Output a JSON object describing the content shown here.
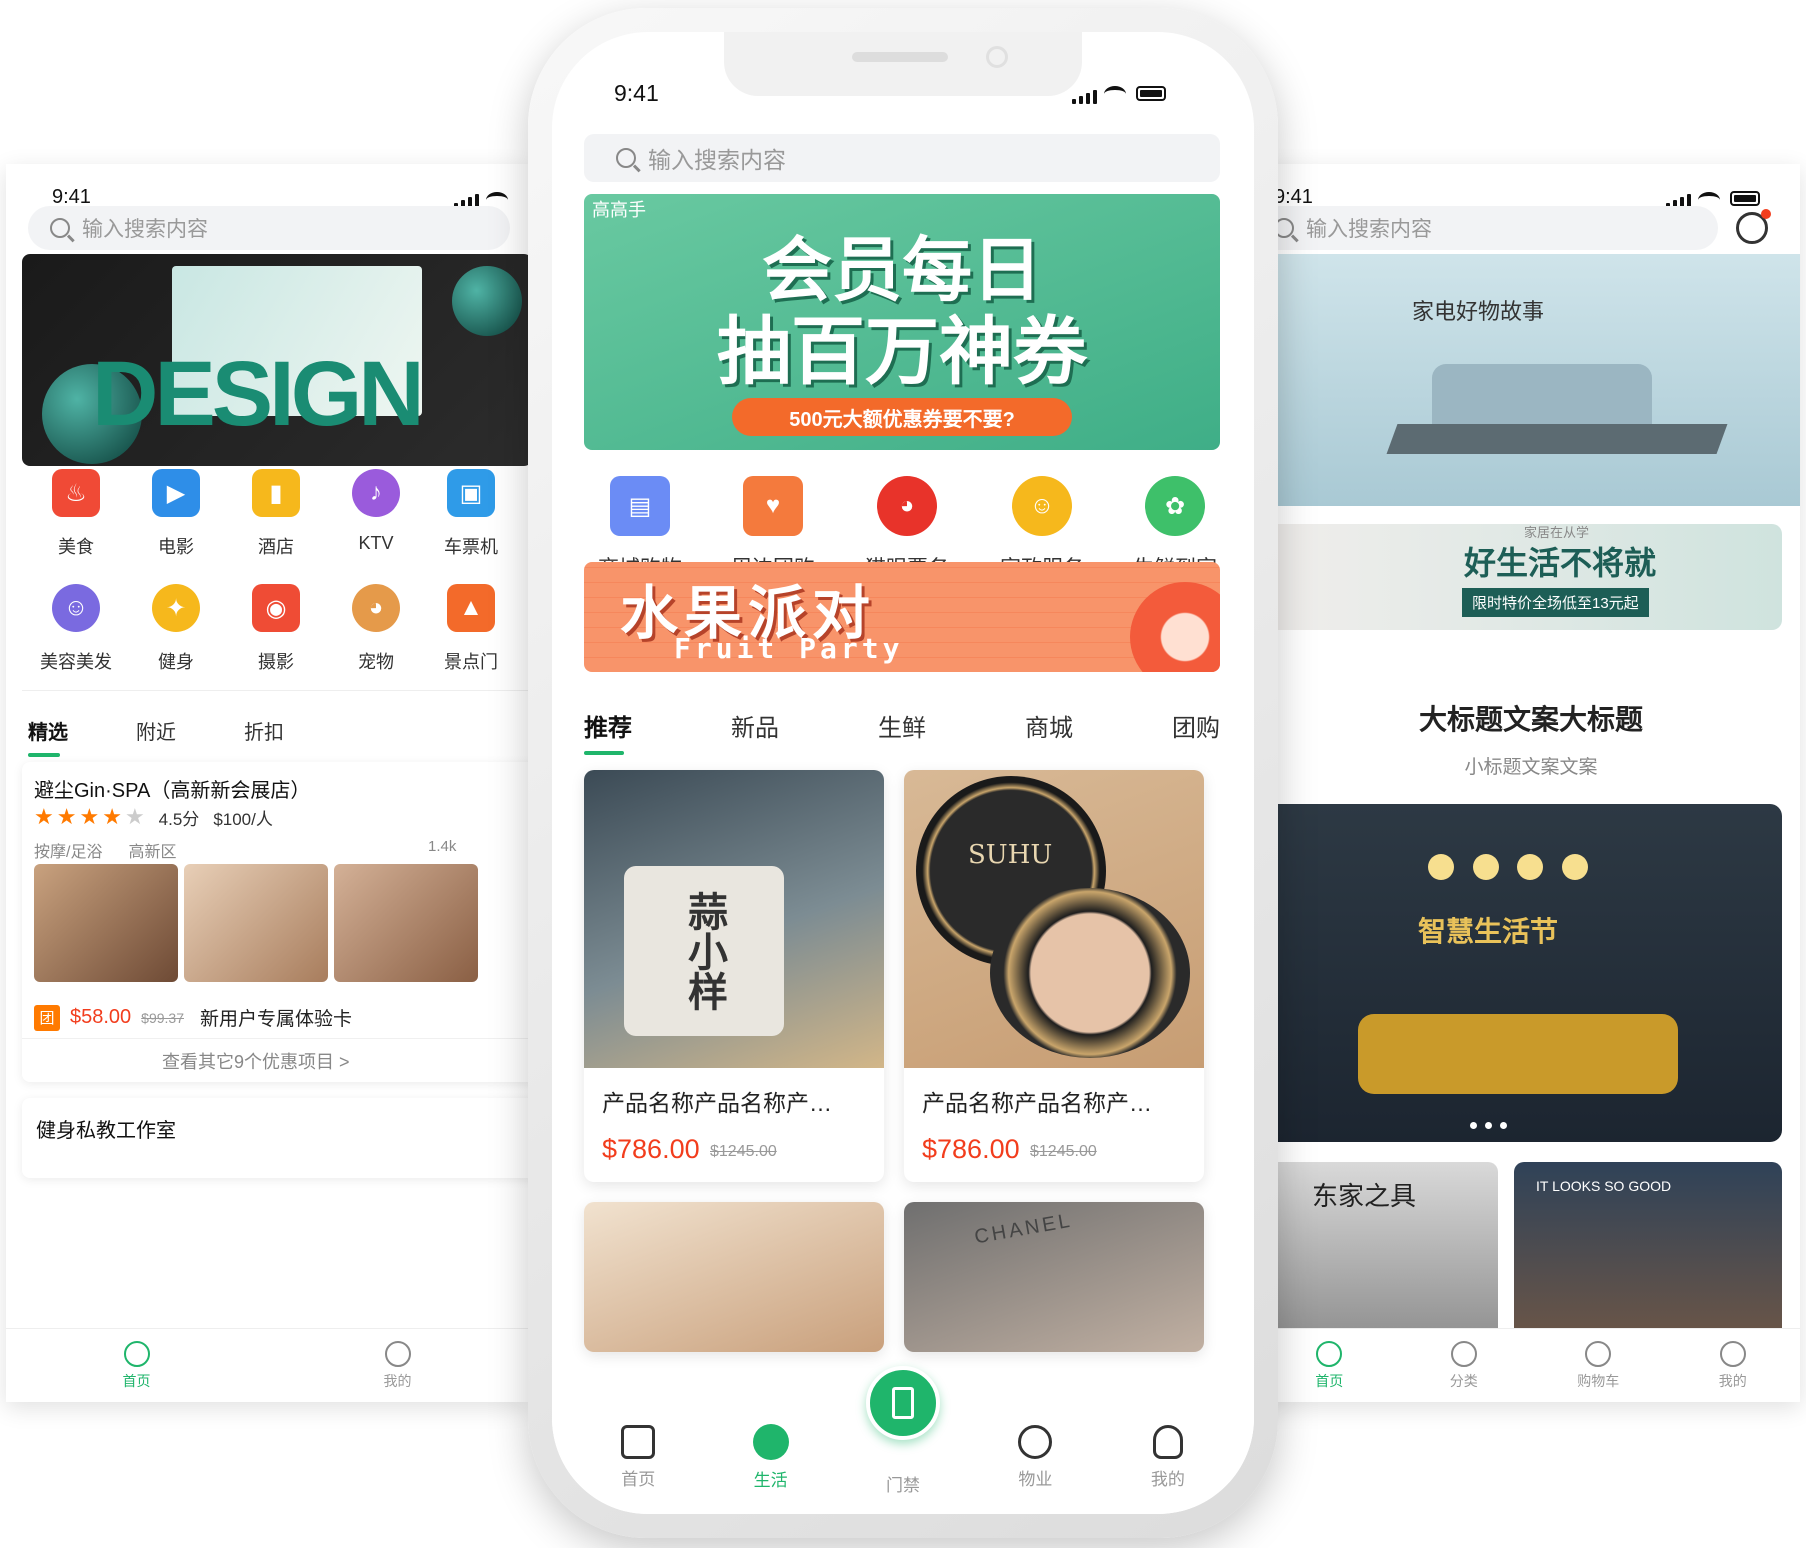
{
  "left": {
    "time": "9:41",
    "search_placeholder": "输入搜索内容",
    "banner_text": "DESIGN",
    "categories_row1": [
      "美食",
      "电影",
      "酒店",
      "KTV",
      "车票机"
    ],
    "categories_row2": [
      "美容美发",
      "健身",
      "摄影",
      "宠物",
      "景点门"
    ],
    "tabs": [
      "精选",
      "附近",
      "折扣"
    ],
    "shop": {
      "name": "避尘Gin·SPA（高新新会展店）",
      "score": "4.5分",
      "rating": 4,
      "per_person": "$100/人",
      "tags": "按摩/足浴",
      "district": "高新区",
      "distance": "1.4k",
      "deal_badge": "团",
      "deal_price": "$58.00",
      "deal_old": "$99.37",
      "deal_title": "新用户专属体验卡",
      "more": "查看其它9个优惠项目 >"
    },
    "next_shop": "健身私教工作室",
    "tabbar": [
      "首页",
      "我的"
    ]
  },
  "center": {
    "time": "9:41",
    "search_placeholder": "输入搜索内容",
    "banner": {
      "brand": "高高手",
      "line1": "会员每日",
      "line2": "抽百万神券",
      "sub": "500元大额优惠券要不要?"
    },
    "services": [
      "商城购物",
      "周边团购",
      "猫眼票务",
      "家政服务",
      "生鲜到家"
    ],
    "promo": {
      "cn": "水果派对",
      "en": "Fruit Party"
    },
    "tabs": [
      "推荐",
      "新品",
      "生鲜",
      "商城",
      "团购"
    ],
    "products": [
      {
        "name": "产品名称产品名称产…",
        "price": "$786.00",
        "old": "$1245.00",
        "img_text": "蒜小样"
      },
      {
        "name": "产品名称产品名称产…",
        "price": "$786.00",
        "old": "$1245.00",
        "img_text": "SUHU"
      }
    ],
    "peek_text": "CHANEL",
    "tabbar": [
      "首页",
      "生活",
      "门禁",
      "物业",
      "我的"
    ]
  },
  "right": {
    "time": "9:41",
    "search_placeholder": "输入搜索内容",
    "banner1": {
      "title": "家电好物故事"
    },
    "banner2": {
      "small": "家居在从学",
      "title": "好生活不将就",
      "sub": "限时特价全场低至13元起"
    },
    "headline": "大标题文案大标题",
    "subhead": "小标题文案文案",
    "banner3": {
      "title": "智慧生活节"
    },
    "tile1": "东家之具",
    "tile2": "IT LOOKS SO GOOD",
    "tabbar": [
      "首页",
      "分类",
      "购物车",
      "我的"
    ]
  },
  "colors": {
    "accent": "#1fb56b",
    "price": "#f23d1d",
    "star": "#ff7a00"
  }
}
